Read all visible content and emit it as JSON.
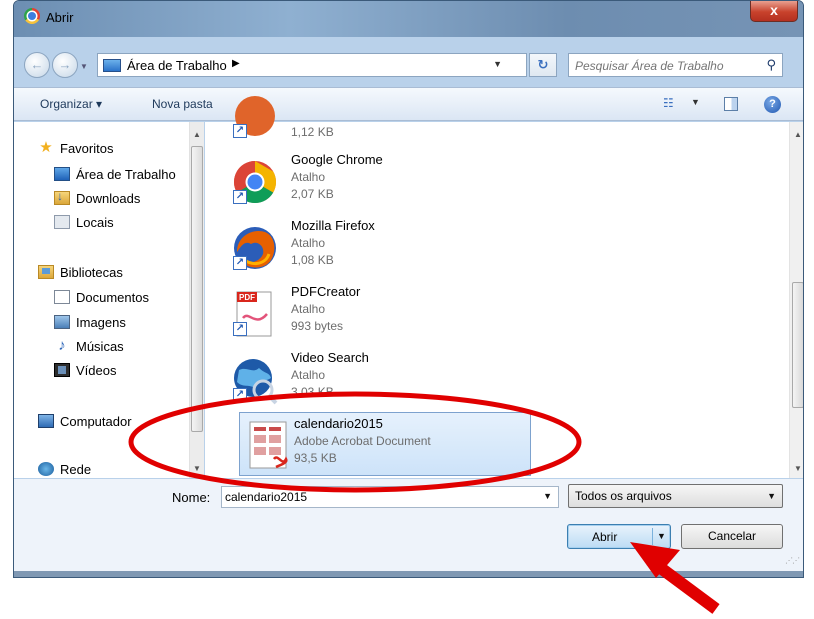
{
  "window": {
    "title": "Abrir",
    "close_label": "x"
  },
  "navigation": {
    "breadcrumb": "Área de Trabalho",
    "search_placeholder": "Pesquisar Área de Trabalho"
  },
  "toolbar": {
    "organize": "Organizar ▾",
    "new_folder": "Nova pasta",
    "help": "?"
  },
  "sidebar": {
    "items": [
      {
        "label": "Favoritos",
        "icon": "star-icon"
      },
      {
        "label": "Área de Trabalho",
        "icon": "desktop-icon"
      },
      {
        "label": "Downloads",
        "icon": "downloads-icon"
      },
      {
        "label": "Locais",
        "icon": "recent-places-icon"
      },
      {
        "label": "Bibliotecas",
        "icon": "libraries-icon"
      },
      {
        "label": "Documentos",
        "icon": "documents-icon"
      },
      {
        "label": "Imagens",
        "icon": "pictures-icon"
      },
      {
        "label": "Músicas",
        "icon": "music-icon"
      },
      {
        "label": "Vídeos",
        "icon": "videos-icon"
      },
      {
        "label": "Computador",
        "icon": "computer-icon"
      },
      {
        "label": "Rede",
        "icon": "network-icon"
      }
    ]
  },
  "files": [
    {
      "name": "",
      "type": "",
      "size": "1,12 KB",
      "icon": "shortcut-app-icon"
    },
    {
      "name": "Google Chrome",
      "type": "Atalho",
      "size": "2,07 KB",
      "icon": "chrome-icon"
    },
    {
      "name": "Mozilla Firefox",
      "type": "Atalho",
      "size": "1,08 KB",
      "icon": "firefox-icon"
    },
    {
      "name": "PDFCreator",
      "type": "Atalho",
      "size": "993 bytes",
      "icon": "pdfcreator-icon"
    },
    {
      "name": "Video Search",
      "type": "Atalho",
      "size": "3,03 KB",
      "icon": "globe-search-icon"
    },
    {
      "name": "calendario2015",
      "type": "Adobe Acrobat Document",
      "size": "93,5 KB",
      "icon": "pdf-document-icon",
      "selected": true
    }
  ],
  "bottom": {
    "filename_label": "Nome:",
    "filename_value": "calendario2015",
    "filetype": "Todos os arquivos",
    "open_button": "Abrir",
    "cancel_button": "Cancelar"
  },
  "annotations": {
    "ellipse_color": "#e00000",
    "arrow_color": "#e00000"
  }
}
